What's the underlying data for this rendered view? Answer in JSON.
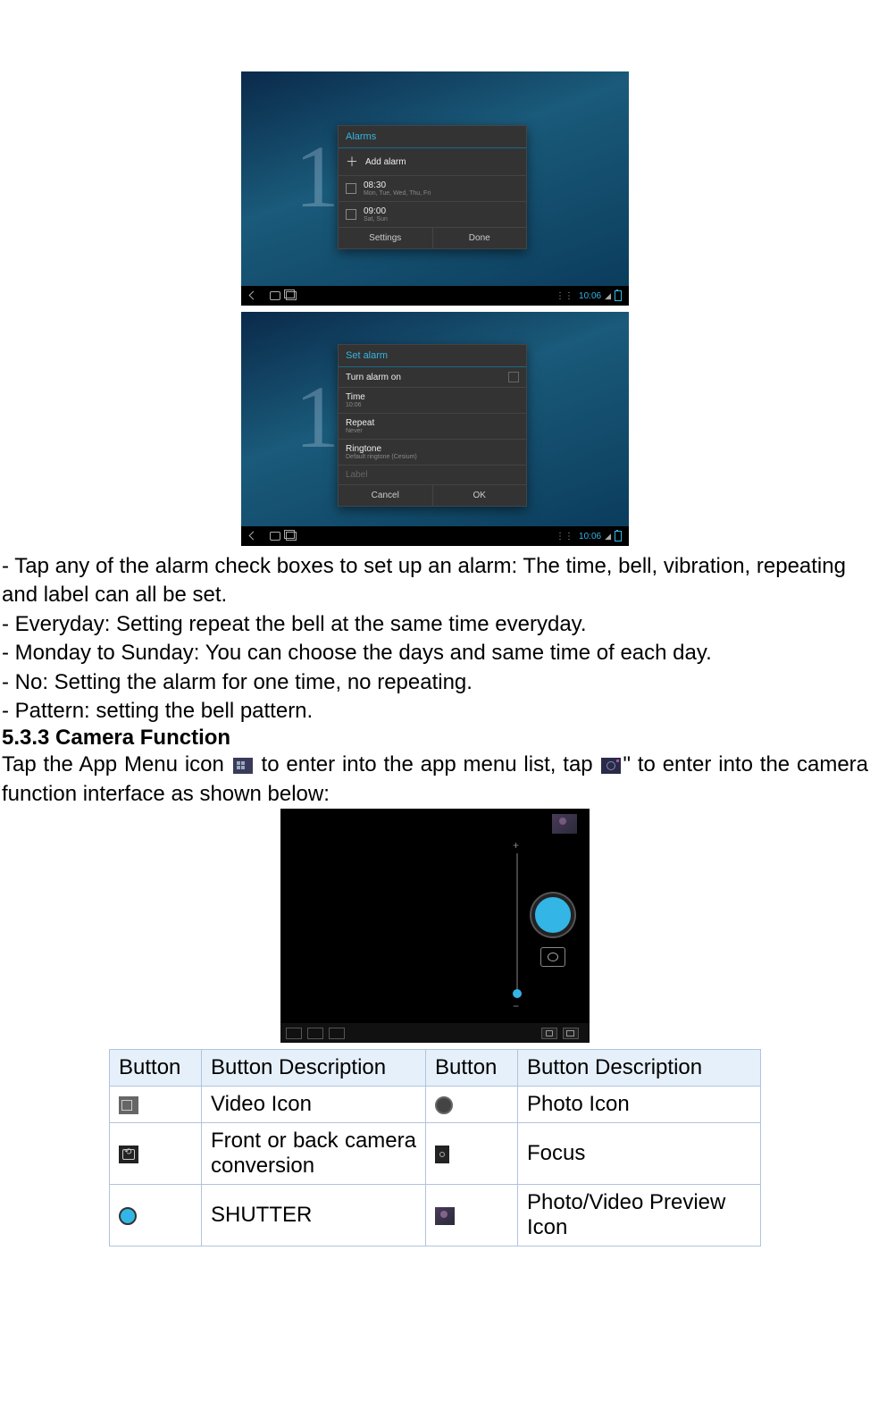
{
  "screenshot1": {
    "dialog_title": "Alarms",
    "row_add": "Add alarm",
    "alarm1_time": "08:30",
    "alarm1_days": "Mon, Tue, Wed, Thu, Fri",
    "alarm2_time": "09:00",
    "alarm2_days": "Sat, Sun",
    "btn_settings": "Settings",
    "btn_done": "Done",
    "nav_time": "10:06"
  },
  "screenshot2": {
    "dialog_title": "Set alarm",
    "row_turn_on": "Turn alarm on",
    "row_time_k": "Time",
    "row_time_v": "10:06",
    "row_repeat_k": "Repeat",
    "row_repeat_v": "Never",
    "row_ringtone_k": "Ringtone",
    "row_ringtone_v": "Default ringtone (Cesium)",
    "row_label_k": "Label",
    "btn_cancel": "Cancel",
    "btn_ok": "OK",
    "nav_time": "10:06"
  },
  "body": {
    "p1": "- Tap any of the alarm check boxes to set up an alarm: The time, bell, vibration, repeating and label can all be set.",
    "p2": "- Everyday: Setting repeat the bell at the same time everyday.",
    "p3": "- Monday to Sunday: You can choose the days and same time of each day.",
    "p4": "- No: Setting the alarm for one time, no repeating.",
    "p5": "- Pattern: setting the bell pattern."
  },
  "heading": "5.3.3 Camera Function",
  "camera_para": {
    "seg1": "Tap the App Menu icon ",
    "seg2": " to enter into the app menu list, tap ",
    "seg3": "\" to enter into the camera function interface as shown below:"
  },
  "table": {
    "h1": "Button",
    "h2": "Button Description",
    "h3": "Button",
    "h4": "Button Description",
    "r1c2": "Video Icon",
    "r1c4": "Photo Icon",
    "r2c2": "Front or back camera conversion",
    "r2c4": "Focus",
    "r3c2": "SHUTTER",
    "r3c4": "Photo/Video Preview Icon"
  }
}
